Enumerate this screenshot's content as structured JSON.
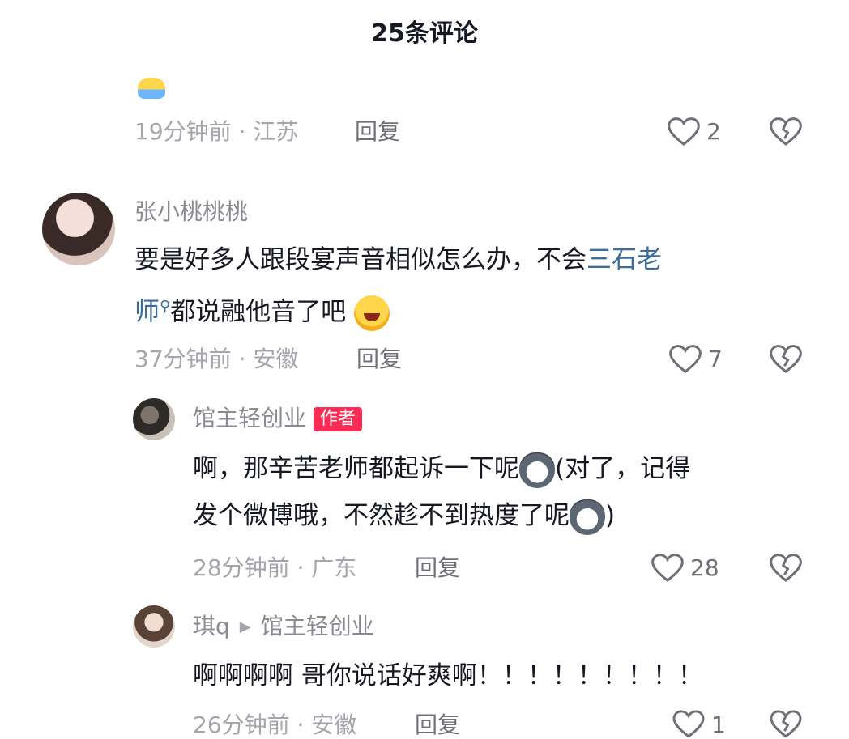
{
  "header": {
    "title": "25条评论"
  },
  "colors": {
    "accent_link": "#3c6e9c",
    "author_badge": "#fe2c55",
    "meta": "#a4a6ac"
  },
  "comments": [
    {
      "emoji": "crying-face",
      "meta": "19分钟前 · 江苏",
      "reply": "回复",
      "likes": "2"
    },
    {
      "name": "张小桃桃桃",
      "text_line1_pre": "要是好多人跟段宴声音相似怎么办，不会",
      "text_line1_link": "三石老",
      "text_line2_link": "师",
      "text_line2_post": "都说融他音了吧",
      "emoji": "laughing-crying-face",
      "meta": "37分钟前 · 安徽",
      "reply": "回复",
      "likes": "7"
    },
    {
      "name": "馆主轻创业",
      "badge": "作者",
      "text_line1_a": "啊，那辛苦老师都起诉一下呢",
      "text_line1_b": "(对了，记得",
      "text_line2_a": "发个微博哦，不然趁不到热度了呢",
      "text_line2_b": ")",
      "emoji": "husky",
      "meta": "28分钟前 · 广东",
      "reply": "回复",
      "likes": "28"
    },
    {
      "name": "琪q",
      "reply_to": "馆主轻创业",
      "text": "啊啊啊啊 哥你说话好爽啊！！！！！！！！！",
      "meta": "26分钟前 · 安徽",
      "reply": "回复",
      "likes": "1"
    }
  ],
  "icons": [
    "heart-outline-icon",
    "dislike-broken-heart-icon",
    "search-link-icon",
    "reply-arrow-icon"
  ]
}
